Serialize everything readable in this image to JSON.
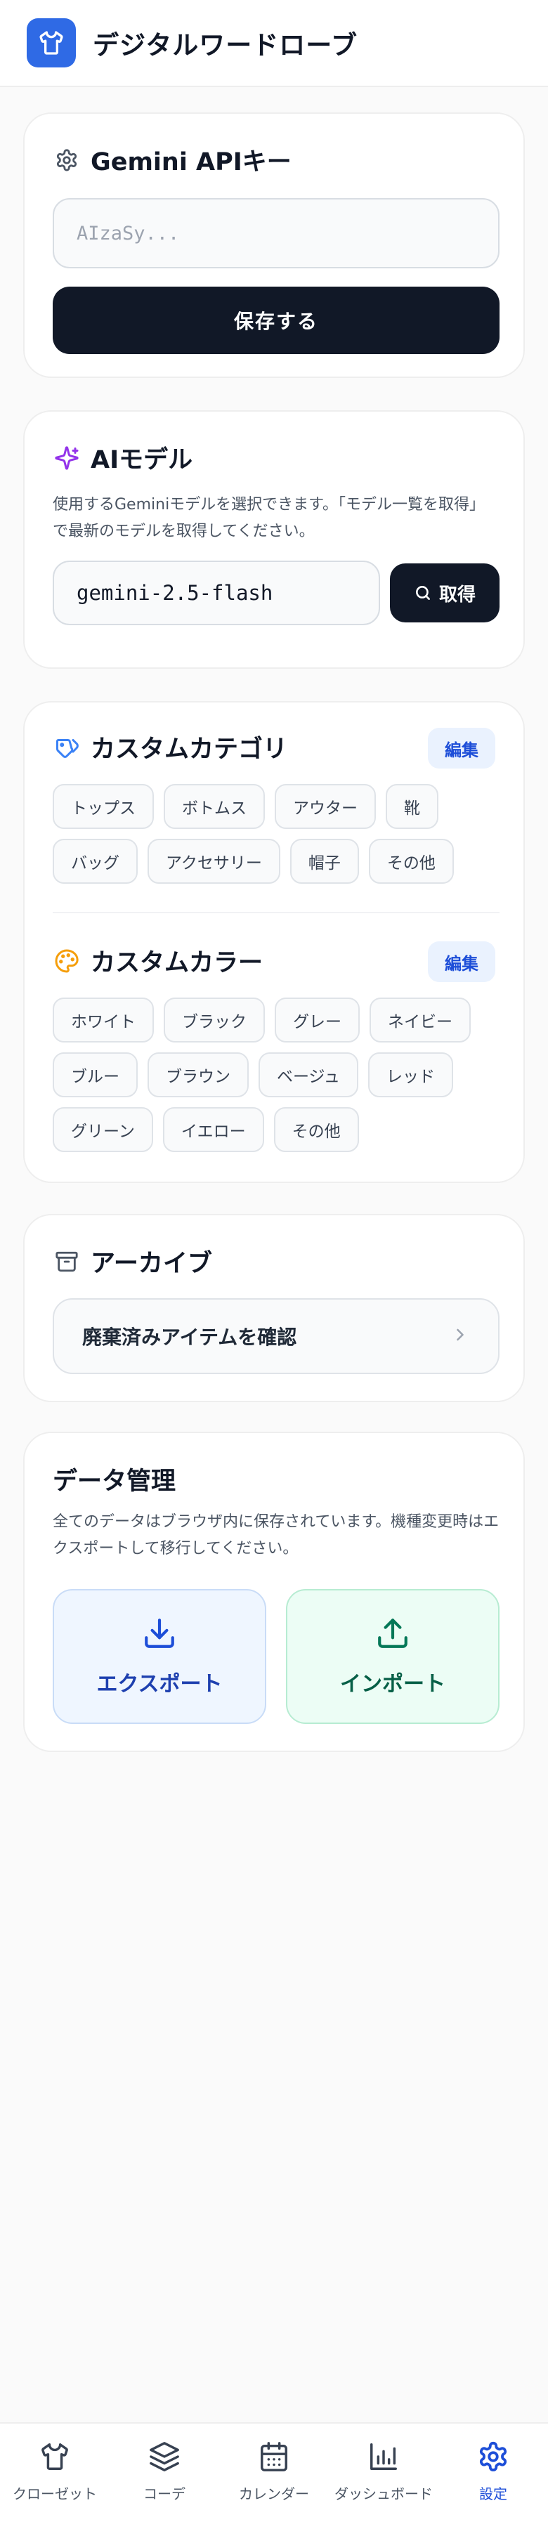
{
  "app": {
    "title": "デジタルワードローブ",
    "accent_color": "#2f6ae5",
    "logo_icon": "shirt-icon"
  },
  "api_key_card": {
    "title": "Gemini APIキー",
    "icon": "gear-icon",
    "input_value": "",
    "input_placeholder": "AIzaSy...",
    "save_label": "保存する"
  },
  "model_card": {
    "title": "AIモデル",
    "icon": "sparkles-icon",
    "description": "使用するGeminiモデルを選択できます。「モデル一覧を取得」で最新のモデルを取得してください。",
    "selected_model": "gemini-2.5-flash",
    "fetch_label": "取得"
  },
  "categories": {
    "title": "カスタムカテゴリ",
    "icon": "tags-icon",
    "edit_label": "編集",
    "items": [
      "トップス",
      "ボトムス",
      "アウター",
      "靴",
      "バッグ",
      "アクセサリー",
      "帽子",
      "その他"
    ]
  },
  "colors": {
    "title": "カスタムカラー",
    "icon": "palette-icon",
    "edit_label": "編集",
    "items": [
      "ホワイト",
      "ブラック",
      "グレー",
      "ネイビー",
      "ブルー",
      "ブラウン",
      "ベージュ",
      "レッド",
      "グリーン",
      "イエロー",
      "その他"
    ]
  },
  "archive": {
    "title": "アーカイブ",
    "icon": "archive-icon",
    "row_label": "廃棄済みアイテムを確認"
  },
  "data_management": {
    "title": "データ管理",
    "description": "全てのデータはブラウザ内に保存されています。機種変更時はエクスポートして移行してください。",
    "export_label": "エクスポート",
    "import_label": "インポート"
  },
  "bottom_nav": {
    "active": "settings",
    "items": [
      {
        "label": "クローゼット",
        "icon": "shirt-icon"
      },
      {
        "label": "コーデ",
        "icon": "layers-icon"
      },
      {
        "label": "カレンダー",
        "icon": "calendar-icon"
      },
      {
        "label": "ダッシュボード",
        "icon": "bar-chart-icon"
      },
      {
        "label": "設定",
        "icon": "gear-icon"
      }
    ]
  }
}
